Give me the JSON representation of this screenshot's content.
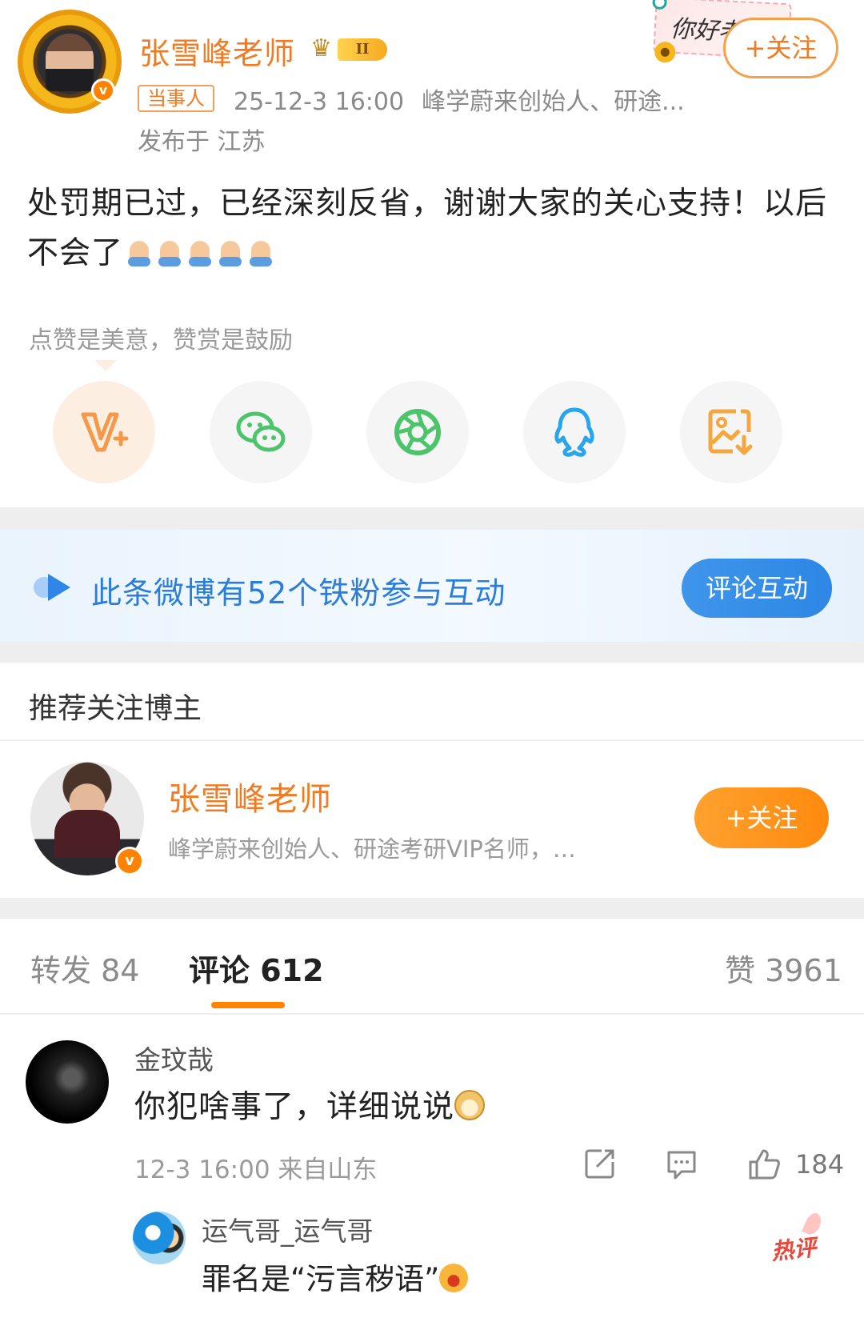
{
  "post": {
    "author_name": "张雪峰老师",
    "level_badge": "II",
    "party_tag": "当事人",
    "timestamp": "25-12-3 16:00",
    "author_desc_short": "峰学蔚来创始人、研途...",
    "location": "发布于 江苏",
    "decoration_text": "你好老师",
    "follow_label": "+关注",
    "body_text": "处罚期已过，已经深刻反省，谢谢大家的关心支持！以后不会了",
    "emoji_count": 5
  },
  "appreciate": {
    "hint": "点赞是美意，赞赏是鼓励"
  },
  "share_buttons": [
    {
      "icon": "weibo-reward-icon",
      "color": "#f4984a"
    },
    {
      "icon": "wechat-icon",
      "color": "#4cc46b"
    },
    {
      "icon": "moments-icon",
      "color": "#4cc46b"
    },
    {
      "icon": "qq-icon",
      "color": "#2aa5ea"
    },
    {
      "icon": "save-image-icon",
      "color": "#f4a640"
    }
  ],
  "fans_banner": {
    "text": "此条微博有52个铁粉参与互动",
    "button": "评论互动"
  },
  "recommend": {
    "title": "推荐关注博主",
    "name": "张雪峰老师",
    "desc": "峰学蔚来创始人、研途考研VIP名师，…",
    "follow_label": "+关注"
  },
  "tabs": {
    "repost": "转发 84",
    "comments": "评论 612",
    "likes": "赞 3961"
  },
  "comment": {
    "user": "金玟哉",
    "text": "你犯啥事了，详细说说",
    "time": "12-3 16:00 来自山东",
    "likes": "184",
    "reply": {
      "user": "运气哥_运气哥",
      "text": "罪名是“污言秽语”",
      "hot_tag": "热评"
    }
  },
  "colors": {
    "accent_orange": "#ff8200",
    "name_orange": "#f07b22",
    "banner_blue": "#2d87e4"
  }
}
